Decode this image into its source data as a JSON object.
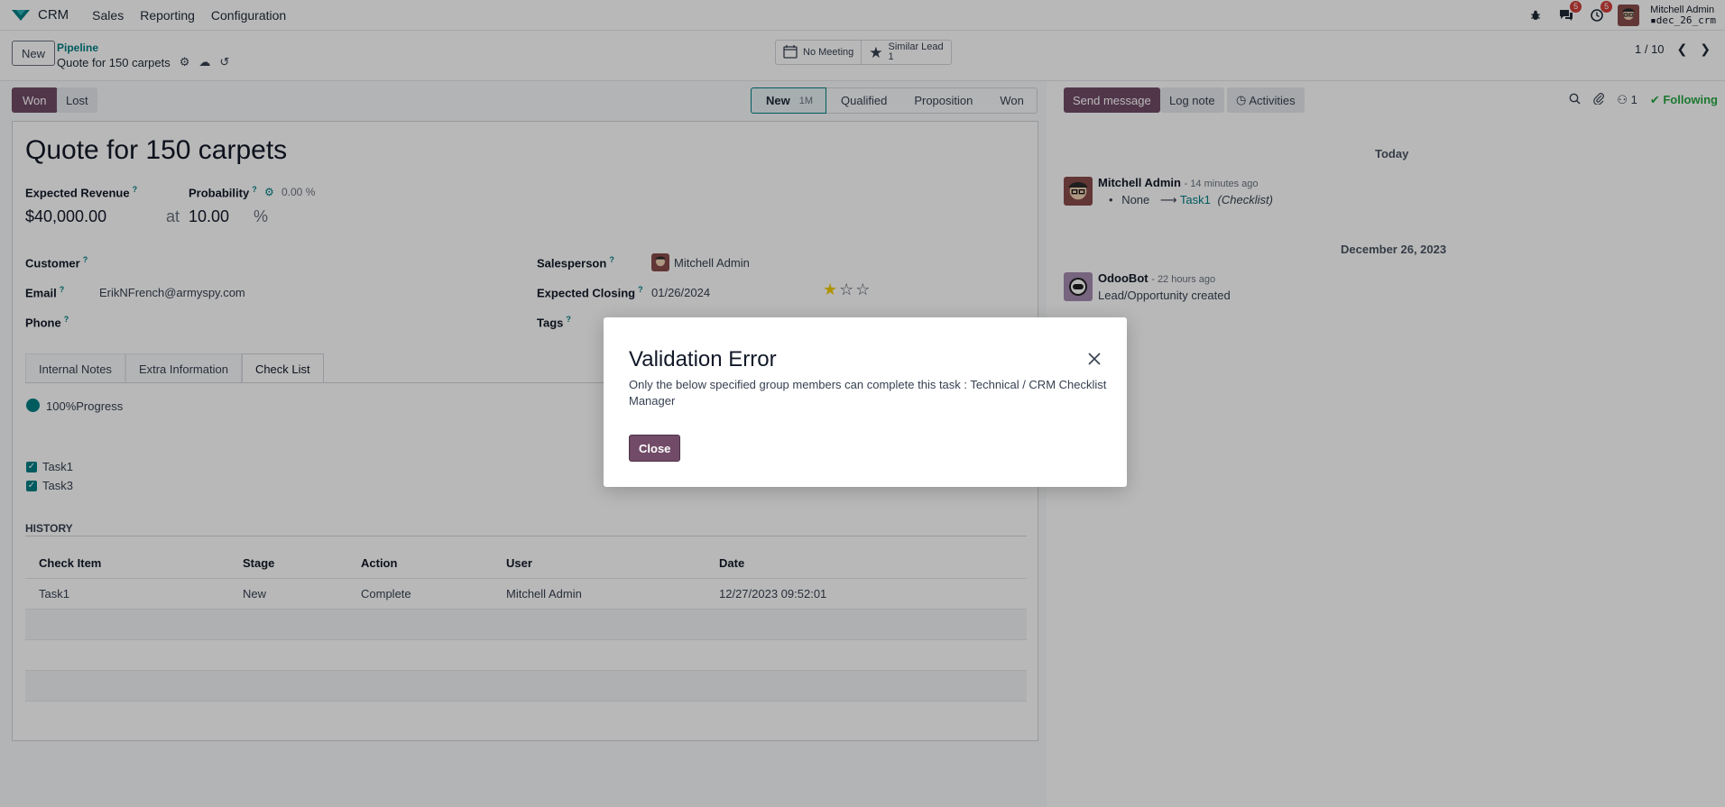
{
  "topnav": {
    "app_name": "CRM",
    "menus": [
      "Sales",
      "Reporting",
      "Configuration"
    ],
    "messages_badge": "5",
    "activities_badge": "5",
    "user_name": "Mitchell Admin",
    "user_db": "dec_26_crm"
  },
  "control": {
    "new_label": "New",
    "crumb_parent": "Pipeline",
    "crumb_current": "Quote for 150 carpets",
    "smart_meeting": "No Meeting",
    "smart_similar_label": "Similar Lead",
    "smart_similar_count": "1",
    "pager": "1 / 10"
  },
  "header": {
    "won_label": "Won",
    "lost_label": "Lost",
    "stages": [
      {
        "label": "New",
        "count": "1M"
      },
      {
        "label": "Qualified"
      },
      {
        "label": "Proposition"
      },
      {
        "label": "Won"
      }
    ]
  },
  "form": {
    "title": "Quote for 150 carpets",
    "expected_revenue_label": "Expected Revenue",
    "expected_revenue": "$40,000.00",
    "at": "at",
    "probability_label": "Probability",
    "probability_auto": "0.00 %",
    "probability": "10.00",
    "percent": "%",
    "customer_label": "Customer",
    "email_label": "Email",
    "email": "ErikNFrench@armyspy.com",
    "phone_label": "Phone",
    "salesperson_label": "Salesperson",
    "salesperson": "Mitchell Admin",
    "expected_closing_label": "Expected Closing",
    "expected_closing": "01/26/2024",
    "priority_stars": 1,
    "tags_label": "Tags",
    "tabs": [
      "Internal Notes",
      "Extra Information",
      "Check List"
    ],
    "progress": "100%Progress",
    "checklist": [
      "Task1",
      "Task3"
    ],
    "history_title": "HISTORY",
    "history_headers": [
      "Check Item",
      "Stage",
      "Action",
      "User",
      "Date"
    ],
    "history_rows": [
      [
        "Task1",
        "New",
        "Complete",
        "Mitchell Admin",
        "12/27/2023 09:52:01"
      ]
    ]
  },
  "chatter": {
    "send_message": "Send message",
    "log_note": "Log note",
    "activities": "Activities",
    "followers_count": "1",
    "following": "Following",
    "today": "Today",
    "msg1_author": "Mitchell Admin",
    "msg1_time": "- 14 minutes ago",
    "msg1_old": "None",
    "msg1_new": "Task1",
    "msg1_field": "(Checklist)",
    "date2": "December 26, 2023",
    "msg2_author": "OdooBot",
    "msg2_time": "- 22 hours ago",
    "msg2_body": "Lead/Opportunity created"
  },
  "modal": {
    "title": "Validation Error",
    "body": "Only the below specified group members can complete this task : Technical / CRM Checklist Manager",
    "close_label": "Close"
  },
  "colors": {
    "primary": "#714b67",
    "accent": "#017e84",
    "following": "#28a745",
    "badge": "#d23f3a"
  }
}
